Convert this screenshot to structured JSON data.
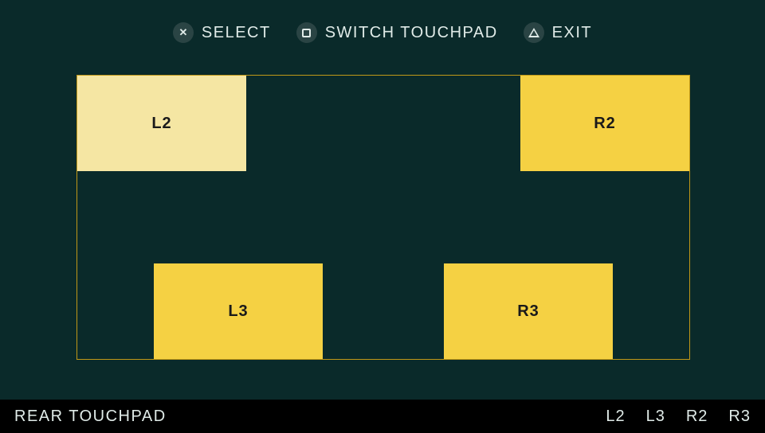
{
  "header": {
    "select": {
      "icon": "cross-icon",
      "label": "SELECT"
    },
    "switch": {
      "icon": "square-icon",
      "label": "SWITCH TOUCHPAD"
    },
    "exit": {
      "icon": "triangle-icon",
      "label": "EXIT"
    }
  },
  "touchpad": {
    "zones": {
      "l2": "L2",
      "r2": "R2",
      "l3": "L3",
      "r3": "R3"
    }
  },
  "footer": {
    "label": "REAR TOUCHPAD",
    "indicators": [
      "L2",
      "L3",
      "R2",
      "R3"
    ]
  }
}
